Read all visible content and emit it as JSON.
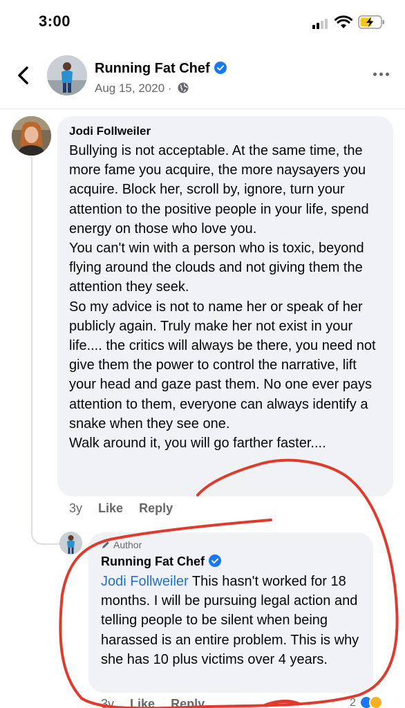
{
  "status_bar": {
    "time": "3:00"
  },
  "header": {
    "page_name": "Running Fat Chef",
    "date": "Aug 15, 2020",
    "separator": "·"
  },
  "comment": {
    "author": "Jodi Follweiler",
    "text": "Bullying is not acceptable. At the same time, the more fame you acquire, the more naysayers you acquire. Block her, scroll by, ignore, turn your attention to the positive people in your life, spend energy on those who love you.\nYou can't win with a person who is toxic, beyond flying around the clouds and not giving them the attention they seek.\nSo my advice is not to name her or speak of her publicly again. Truly make her not exist in your life.... the critics will always be there, you need not give them the power to control the narrative, lift your head and gaze past them. No one ever pays attention to them, everyone can always identify a snake when they see one.\nWalk around it, you will go farther faster....",
    "time": "3y",
    "like_label": "Like",
    "reply_label": "Reply"
  },
  "reply": {
    "badge": "Author",
    "author": "Running Fat Chef",
    "mention": "Jodi Follweiler",
    "text": " This hasn't worked for 18 months. I will be pursuing legal action and telling people to be silent when being harassed is an entire problem. This is why she has 10 plus victims over 4 years.",
    "time": "3y",
    "like_label": "Like",
    "reply_label": "Reply",
    "reaction_count": "2"
  },
  "colors": {
    "link_blue": "#216fdb",
    "verified_blue": "#1877f2",
    "annotation_red": "#e03a2c",
    "bubble_gray": "#f0f2f5"
  },
  "icons": [
    "back-chevron-icon",
    "verified-badge-icon",
    "globe-icon",
    "more-icon",
    "pencil-icon",
    "like-reaction-icon",
    "care-reaction-icon",
    "signal-icon",
    "wifi-icon",
    "battery-charging-icon"
  ]
}
